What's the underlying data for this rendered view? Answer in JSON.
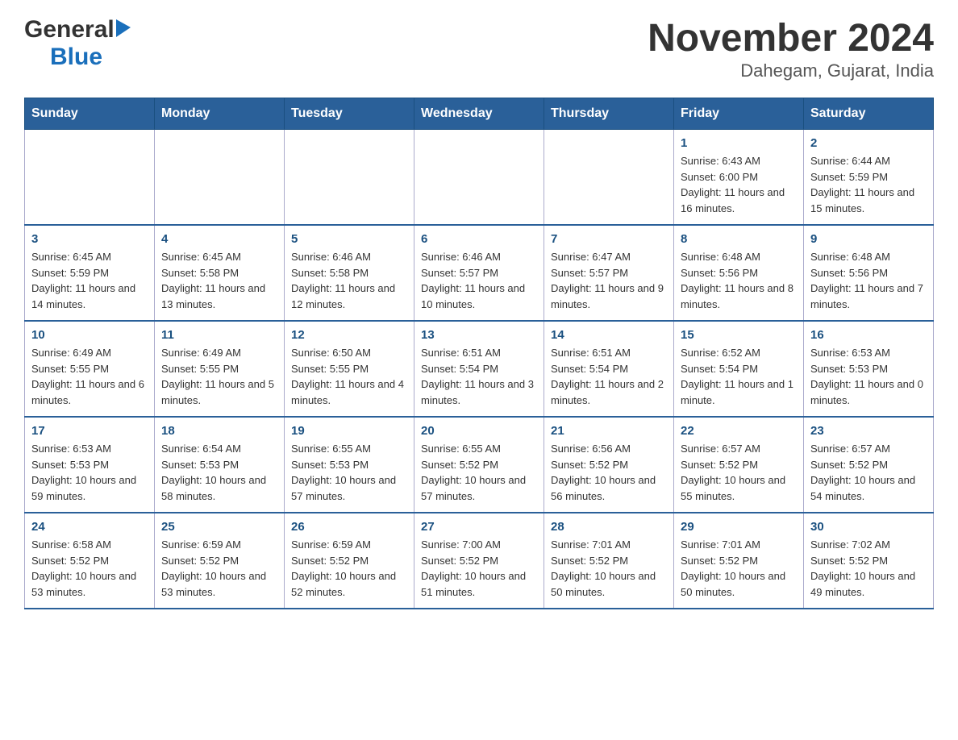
{
  "header": {
    "logo": {
      "general_text": "General",
      "blue_text": "Blue"
    },
    "title": "November 2024",
    "subtitle": "Dahegam, Gujarat, India"
  },
  "calendar": {
    "weekdays": [
      "Sunday",
      "Monday",
      "Tuesday",
      "Wednesday",
      "Thursday",
      "Friday",
      "Saturday"
    ],
    "weeks": [
      [
        {
          "day": "",
          "info": ""
        },
        {
          "day": "",
          "info": ""
        },
        {
          "day": "",
          "info": ""
        },
        {
          "day": "",
          "info": ""
        },
        {
          "day": "",
          "info": ""
        },
        {
          "day": "1",
          "info": "Sunrise: 6:43 AM\nSunset: 6:00 PM\nDaylight: 11 hours and 16 minutes."
        },
        {
          "day": "2",
          "info": "Sunrise: 6:44 AM\nSunset: 5:59 PM\nDaylight: 11 hours and 15 minutes."
        }
      ],
      [
        {
          "day": "3",
          "info": "Sunrise: 6:45 AM\nSunset: 5:59 PM\nDaylight: 11 hours and 14 minutes."
        },
        {
          "day": "4",
          "info": "Sunrise: 6:45 AM\nSunset: 5:58 PM\nDaylight: 11 hours and 13 minutes."
        },
        {
          "day": "5",
          "info": "Sunrise: 6:46 AM\nSunset: 5:58 PM\nDaylight: 11 hours and 12 minutes."
        },
        {
          "day": "6",
          "info": "Sunrise: 6:46 AM\nSunset: 5:57 PM\nDaylight: 11 hours and 10 minutes."
        },
        {
          "day": "7",
          "info": "Sunrise: 6:47 AM\nSunset: 5:57 PM\nDaylight: 11 hours and 9 minutes."
        },
        {
          "day": "8",
          "info": "Sunrise: 6:48 AM\nSunset: 5:56 PM\nDaylight: 11 hours and 8 minutes."
        },
        {
          "day": "9",
          "info": "Sunrise: 6:48 AM\nSunset: 5:56 PM\nDaylight: 11 hours and 7 minutes."
        }
      ],
      [
        {
          "day": "10",
          "info": "Sunrise: 6:49 AM\nSunset: 5:55 PM\nDaylight: 11 hours and 6 minutes."
        },
        {
          "day": "11",
          "info": "Sunrise: 6:49 AM\nSunset: 5:55 PM\nDaylight: 11 hours and 5 minutes."
        },
        {
          "day": "12",
          "info": "Sunrise: 6:50 AM\nSunset: 5:55 PM\nDaylight: 11 hours and 4 minutes."
        },
        {
          "day": "13",
          "info": "Sunrise: 6:51 AM\nSunset: 5:54 PM\nDaylight: 11 hours and 3 minutes."
        },
        {
          "day": "14",
          "info": "Sunrise: 6:51 AM\nSunset: 5:54 PM\nDaylight: 11 hours and 2 minutes."
        },
        {
          "day": "15",
          "info": "Sunrise: 6:52 AM\nSunset: 5:54 PM\nDaylight: 11 hours and 1 minute."
        },
        {
          "day": "16",
          "info": "Sunrise: 6:53 AM\nSunset: 5:53 PM\nDaylight: 11 hours and 0 minutes."
        }
      ],
      [
        {
          "day": "17",
          "info": "Sunrise: 6:53 AM\nSunset: 5:53 PM\nDaylight: 10 hours and 59 minutes."
        },
        {
          "day": "18",
          "info": "Sunrise: 6:54 AM\nSunset: 5:53 PM\nDaylight: 10 hours and 58 minutes."
        },
        {
          "day": "19",
          "info": "Sunrise: 6:55 AM\nSunset: 5:53 PM\nDaylight: 10 hours and 57 minutes."
        },
        {
          "day": "20",
          "info": "Sunrise: 6:55 AM\nSunset: 5:52 PM\nDaylight: 10 hours and 57 minutes."
        },
        {
          "day": "21",
          "info": "Sunrise: 6:56 AM\nSunset: 5:52 PM\nDaylight: 10 hours and 56 minutes."
        },
        {
          "day": "22",
          "info": "Sunrise: 6:57 AM\nSunset: 5:52 PM\nDaylight: 10 hours and 55 minutes."
        },
        {
          "day": "23",
          "info": "Sunrise: 6:57 AM\nSunset: 5:52 PM\nDaylight: 10 hours and 54 minutes."
        }
      ],
      [
        {
          "day": "24",
          "info": "Sunrise: 6:58 AM\nSunset: 5:52 PM\nDaylight: 10 hours and 53 minutes."
        },
        {
          "day": "25",
          "info": "Sunrise: 6:59 AM\nSunset: 5:52 PM\nDaylight: 10 hours and 53 minutes."
        },
        {
          "day": "26",
          "info": "Sunrise: 6:59 AM\nSunset: 5:52 PM\nDaylight: 10 hours and 52 minutes."
        },
        {
          "day": "27",
          "info": "Sunrise: 7:00 AM\nSunset: 5:52 PM\nDaylight: 10 hours and 51 minutes."
        },
        {
          "day": "28",
          "info": "Sunrise: 7:01 AM\nSunset: 5:52 PM\nDaylight: 10 hours and 50 minutes."
        },
        {
          "day": "29",
          "info": "Sunrise: 7:01 AM\nSunset: 5:52 PM\nDaylight: 10 hours and 50 minutes."
        },
        {
          "day": "30",
          "info": "Sunrise: 7:02 AM\nSunset: 5:52 PM\nDaylight: 10 hours and 49 minutes."
        }
      ]
    ]
  }
}
